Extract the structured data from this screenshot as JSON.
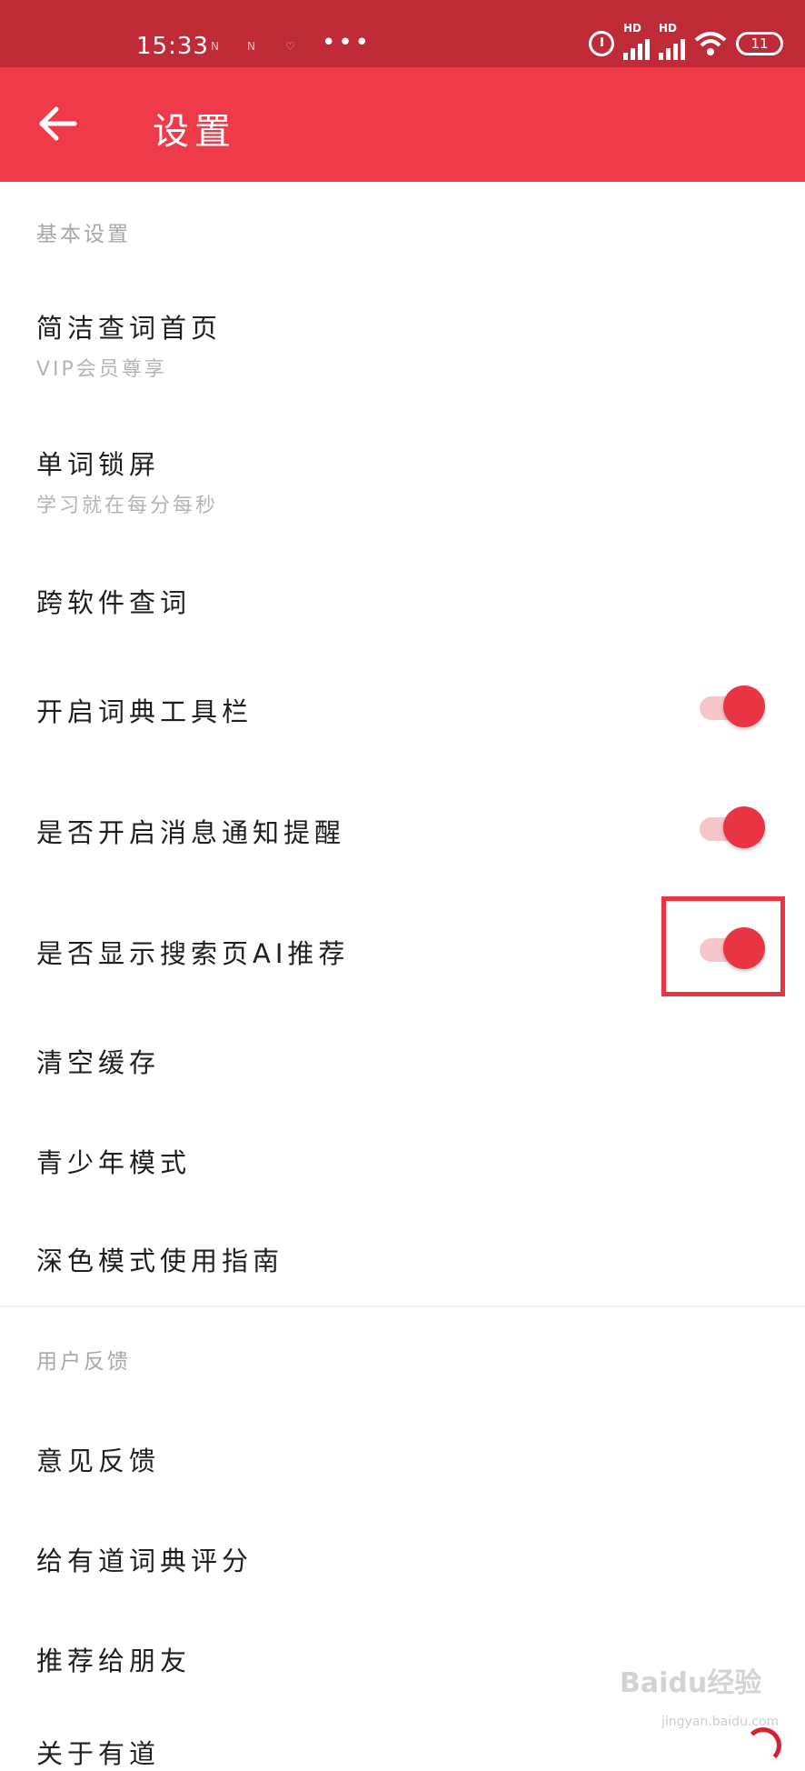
{
  "status_bar": {
    "time": "15:33",
    "mini_icons": [
      "N",
      "N",
      "♡"
    ],
    "dots": "•••",
    "hd_label_1": "HD",
    "hd_label_2": "HD",
    "battery": "11"
  },
  "app_bar": {
    "title": "设置",
    "background_color": "#ef3a49"
  },
  "sections": [
    {
      "header": "基本设置",
      "items": [
        {
          "title": "简洁查词首页",
          "subtitle": "VIP会员尊享"
        },
        {
          "title": "单词锁屏",
          "subtitle": "学习就在每分每秒"
        },
        {
          "title": "跨软件查词"
        },
        {
          "title": "开启词典工具栏",
          "toggle_on": true
        },
        {
          "title": "是否开启消息通知提醒",
          "toggle_on": true
        },
        {
          "title": "是否显示搜索页AI推荐",
          "toggle_on": true,
          "highlighted": true
        },
        {
          "title": "清空缓存"
        },
        {
          "title": "青少年模式"
        },
        {
          "title": "深色模式使用指南"
        }
      ]
    },
    {
      "header": "用户反馈",
      "items": [
        {
          "title": "意见反馈"
        },
        {
          "title": "给有道词典评分"
        },
        {
          "title": "推荐给朋友"
        },
        {
          "title": "关于有道"
        }
      ]
    }
  ],
  "watermark": {
    "text": "Baidu经验",
    "sub": "jingyan.baidu.com"
  },
  "colors": {
    "status_bar": "#c02b38",
    "accent": "#e93443",
    "toggle_track": "#f7c6cb"
  }
}
